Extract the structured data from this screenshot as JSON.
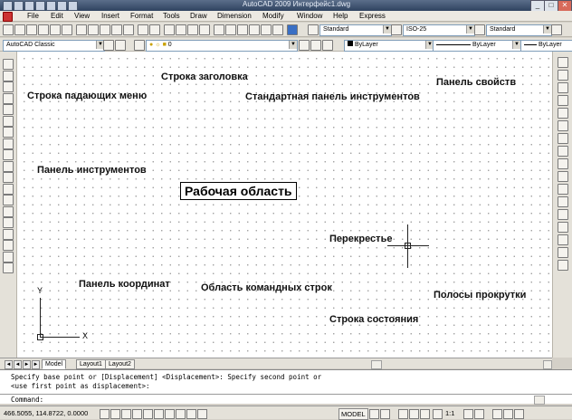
{
  "window": {
    "title": "AutoCAD 2009 Интерфейс1.dwg",
    "minimize": "_",
    "maximize": "□",
    "close": "✕"
  },
  "menu": {
    "items": [
      "File",
      "Edit",
      "View",
      "Insert",
      "Format",
      "Tools",
      "Draw",
      "Dimension",
      "Modify",
      "Window",
      "Help",
      "Express"
    ]
  },
  "toolbar": {
    "text_style": "Standard",
    "dim_style": "ISO-25",
    "table_style": "Standard",
    "workspace": "AutoCAD Classic",
    "layer": "0",
    "color": "ByLayer",
    "linetype": "ByLayer",
    "lineweight": "ByLayer"
  },
  "annotations": {
    "title_row": "Строка заголовка",
    "menu_row": "Строка падающих меню",
    "standard_toolbar": "Стандартная панель инструментов",
    "properties_panel": "Панель свойств",
    "tools_panel": "Панель инструментов",
    "work_area": "Рабочая область",
    "crosshair": "Перекрестье",
    "coordinate_panel": "Панель координат",
    "command_area": "Область командных строк",
    "scrollbars": "Полосы прокрутки",
    "status_bar": "Строка состояния"
  },
  "ucs": {
    "x": "X",
    "y": "Y"
  },
  "tabs": [
    "Model",
    "Layout1",
    "Layout2"
  ],
  "command": {
    "line1": "Specify base point or [Displacement] <Displacement>: Specify second point or",
    "line2": "<use first point as displacement>:",
    "prompt": "Command:"
  },
  "status": {
    "coordinates": "466.5055, 114.8722, 0.0000",
    "model": "MODEL",
    "scale": "1:1"
  },
  "icons": {
    "left": [
      "line-icon",
      "construction-line-icon",
      "polyline-icon",
      "polygon-icon",
      "rectangle-icon",
      "arc-icon",
      "circle-icon",
      "revision-cloud-icon",
      "spline-icon",
      "ellipse-icon",
      "ellipse-arc-icon",
      "insert-block-icon",
      "make-block-icon",
      "point-icon",
      "hatch-icon",
      "gradient-icon",
      "region-icon",
      "table-icon",
      "text-icon"
    ],
    "right": [
      "erase-icon",
      "copy-icon",
      "mirror-icon",
      "offset-icon",
      "array-icon",
      "move-icon",
      "rotate-icon",
      "scale-icon",
      "stretch-icon",
      "trim-icon",
      "extend-icon",
      "break-point-icon",
      "break-icon",
      "join-icon",
      "chamfer-icon",
      "fillet-icon",
      "explode-icon"
    ]
  }
}
